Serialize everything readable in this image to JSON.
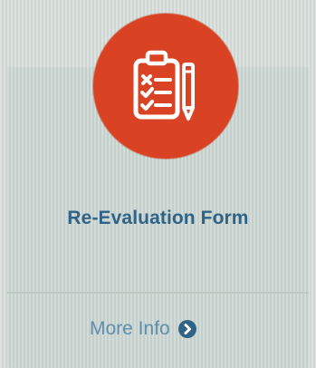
{
  "card": {
    "title": "Re-Evaluation Form",
    "icon": "clipboard-checklist-pencil-icon",
    "icon_bg_color": "#d94323",
    "more_label": "More Info",
    "more_icon": "chevron-circle-right-icon",
    "accent_color": "#2f6387"
  }
}
